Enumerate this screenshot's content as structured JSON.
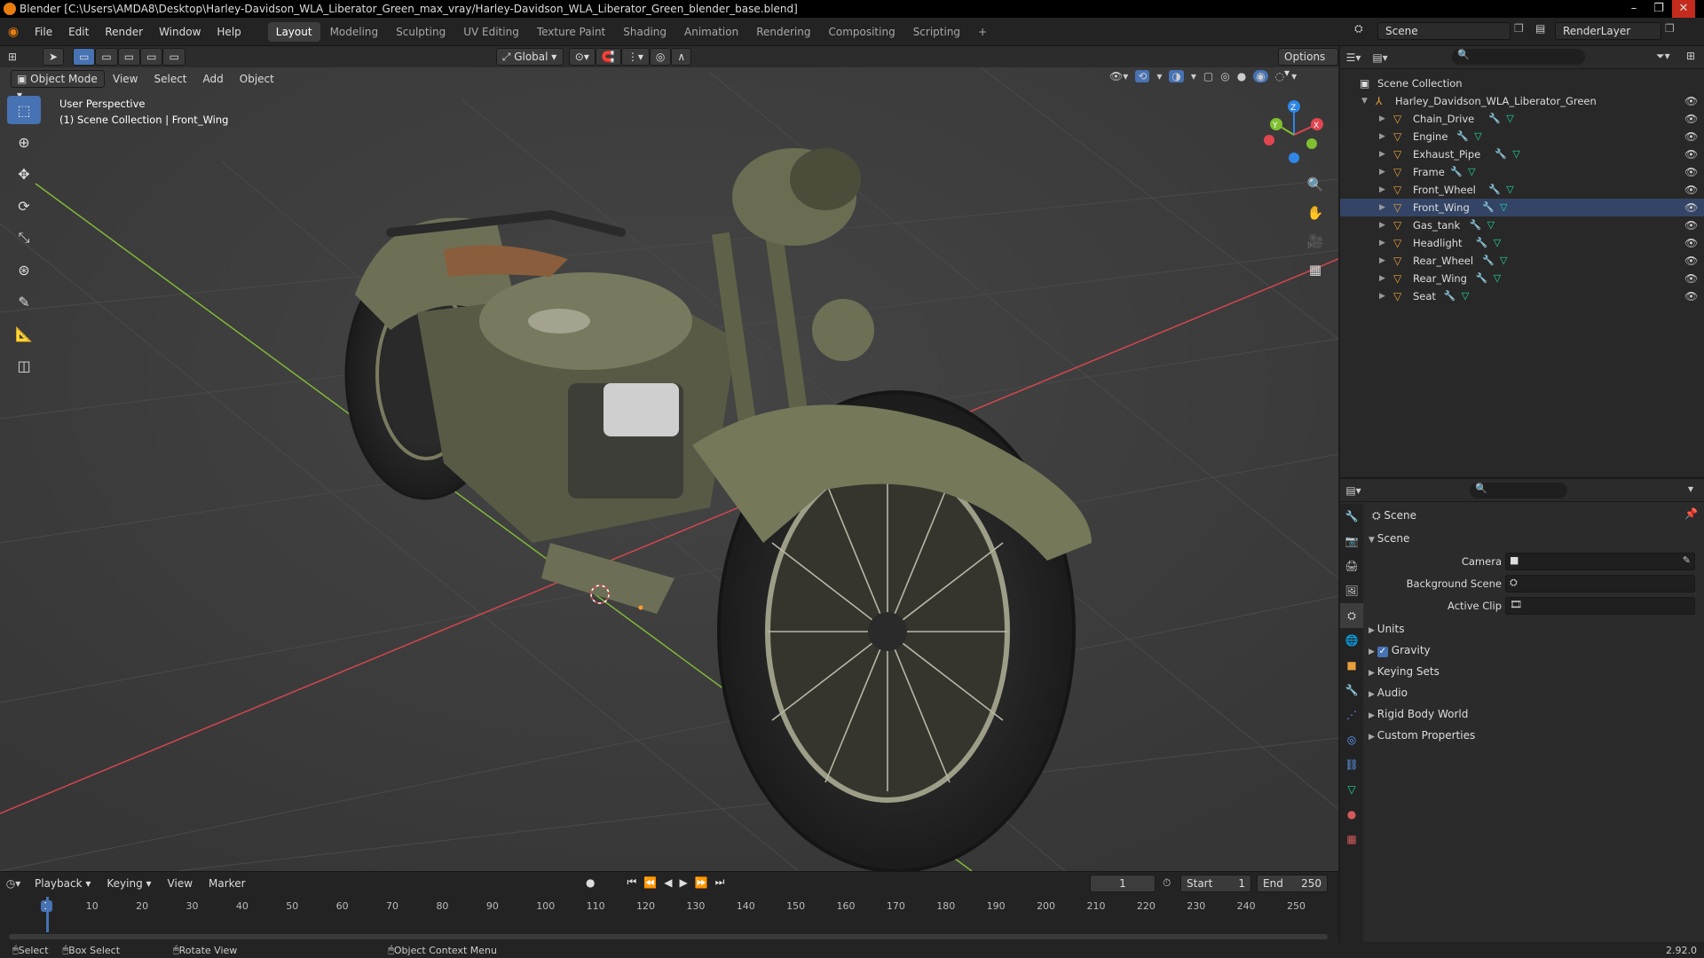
{
  "window": {
    "title": "Blender [C:\\Users\\AMDA8\\Desktop\\Harley-Davidson_WLA_Liberator_Green_max_vray/Harley-Davidson_WLA_Liberator_Green_blender_base.blend]",
    "min": "–",
    "max": "❐",
    "close": "✕"
  },
  "menu": [
    "File",
    "Edit",
    "Render",
    "Window",
    "Help"
  ],
  "workspaces": [
    "Layout",
    "Modeling",
    "Sculpting",
    "UV Editing",
    "Texture Paint",
    "Shading",
    "Animation",
    "Rendering",
    "Compositing",
    "Scripting"
  ],
  "add_workspace": "+",
  "scene_field": "Scene",
  "layer_field": "RenderLayer",
  "viewport": {
    "mode": "Object Mode",
    "menus": [
      "View",
      "Select",
      "Add",
      "Object"
    ],
    "orientation": "Global",
    "options": "Options",
    "info_line1": "User Perspective",
    "info_line2": "(1) Scene Collection | Front_Wing",
    "gizmo_x": "X",
    "gizmo_y": "Y",
    "gizmo_z": "Z",
    "colors": {
      "x_axis": "#e04550",
      "y_axis": "#7fbf30",
      "z_axis": "#2f86e6",
      "grid_bg": "#3d3d3d"
    }
  },
  "outliner": {
    "root": "Scene Collection",
    "object": "Harley_Davidson_WLA_Liberator_Green",
    "children": [
      "Chain_Drive",
      "Engine",
      "Exhaust_Pipe",
      "Frame",
      "Front_Wheel",
      "Front_Wing",
      "Gas_tank",
      "Headlight",
      "Rear_Wheel",
      "Rear_Wing",
      "Seat"
    ]
  },
  "properties": {
    "context": "Scene",
    "panel": "Scene",
    "fields": [
      {
        "label": "Camera"
      },
      {
        "label": "Background Scene"
      },
      {
        "label": "Active Clip"
      }
    ],
    "sections": [
      "Units",
      "Gravity",
      "Keying Sets",
      "Audio",
      "Rigid Body World",
      "Custom Properties"
    ]
  },
  "timeline": {
    "menus": [
      "Playback",
      "Keying",
      "View",
      "Marker"
    ],
    "current_frame": "1",
    "start_label": "Start",
    "start": "1",
    "end_label": "End",
    "end": "250",
    "ticks": [
      "1",
      "10",
      "20",
      "30",
      "40",
      "50",
      "60",
      "70",
      "80",
      "90",
      "100",
      "110",
      "120",
      "130",
      "140",
      "150",
      "160",
      "170",
      "180",
      "190",
      "200",
      "210",
      "220",
      "230",
      "240",
      "250"
    ]
  },
  "status": {
    "select": "Select",
    "box_select": "Box Select",
    "rotate": "Rotate View",
    "context_menu": "Object Context Menu",
    "version": "2.92.0"
  }
}
